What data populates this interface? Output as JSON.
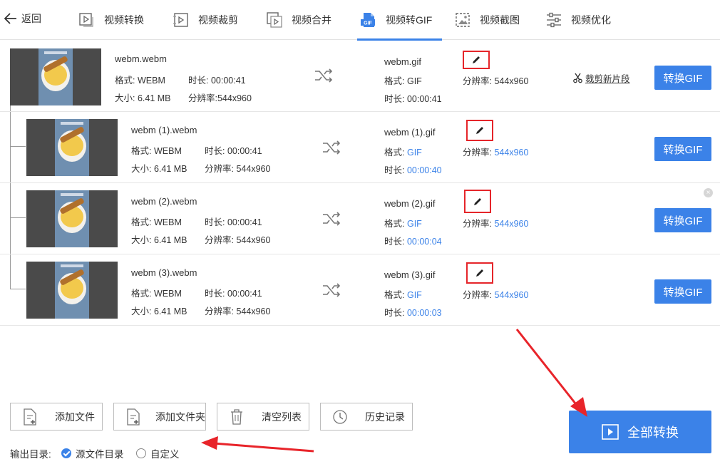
{
  "toolbar": {
    "back_label": "返回",
    "tabs": [
      {
        "label": "视频转换",
        "icon": "video-convert-icon"
      },
      {
        "label": "视频裁剪",
        "icon": "video-crop-icon"
      },
      {
        "label": "视频合并",
        "icon": "video-merge-icon"
      },
      {
        "label": "视频转GIF",
        "icon": "gif-icon",
        "icon_text": "GIF",
        "active": true
      },
      {
        "label": "视频截图",
        "icon": "screenshot-icon"
      },
      {
        "label": "视频优化",
        "icon": "optimize-icon"
      }
    ]
  },
  "files": [
    {
      "source": {
        "name": "webm.webm",
        "format_label": "格式:",
        "format": "WEBM",
        "duration_label": "时长:",
        "duration": "00:00:41",
        "size_label": "大小:",
        "size": "6.41 MB",
        "resolution_label": "分辨率:",
        "resolution": "544x960"
      },
      "output": {
        "name": "webm.gif",
        "format_label": "格式:",
        "format": "GIF",
        "duration_label": "时长:",
        "duration": "00:00:41",
        "resolution_label": "分辨率:",
        "resolution": "544x960"
      },
      "cut_label": "裁剪新片段",
      "convert_label": "转换GIF"
    },
    {
      "source": {
        "name": "webm (1).webm",
        "format_label": "格式:",
        "format": "WEBM",
        "duration_label": "时长:",
        "duration": "00:00:41",
        "size_label": "大小:",
        "size": "6.41 MB",
        "resolution_label": "分辨率:",
        "resolution": "544x960"
      },
      "output": {
        "name": "webm (1).gif",
        "format_label": "格式:",
        "format": "GIF",
        "duration_label": "时长:",
        "duration": "00:00:40",
        "resolution_label": "分辨率:",
        "resolution": "544x960"
      },
      "convert_label": "转换GIF"
    },
    {
      "source": {
        "name": "webm (2).webm",
        "format_label": "格式:",
        "format": "WEBM",
        "duration_label": "时长:",
        "duration": "00:00:41",
        "size_label": "大小:",
        "size": "6.41 MB",
        "resolution_label": "分辨率:",
        "resolution": "544x960"
      },
      "output": {
        "name": "webm (2).gif",
        "format_label": "格式:",
        "format": "GIF",
        "duration_label": "时长:",
        "duration": "00:00:04",
        "resolution_label": "分辨率:",
        "resolution": "544x960"
      },
      "convert_label": "转换GIF"
    },
    {
      "source": {
        "name": "webm (3).webm",
        "format_label": "格式:",
        "format": "WEBM",
        "duration_label": "时长:",
        "duration": "00:00:41",
        "size_label": "大小:",
        "size": "6.41 MB",
        "resolution_label": "分辨率:",
        "resolution": "544x960"
      },
      "output": {
        "name": "webm (3).gif",
        "format_label": "格式:",
        "format": "GIF",
        "duration_label": "时长:",
        "duration": "00:00:03",
        "resolution_label": "分辨率:",
        "resolution": "544x960"
      },
      "convert_label": "转换GIF"
    }
  ],
  "bottom": {
    "add_file": "添加文件",
    "add_folder": "添加文件夹",
    "clear_list": "清空列表",
    "history": "历史记录",
    "output_dir_label": "输出目录:",
    "option_source_dir": "源文件目录",
    "option_custom": "自定义",
    "selected_option": "源文件目录",
    "convert_all": "全部转换"
  },
  "colors": {
    "accent": "#3b82e8",
    "highlight": "#e5252a",
    "output_value": "#3b82e8"
  }
}
